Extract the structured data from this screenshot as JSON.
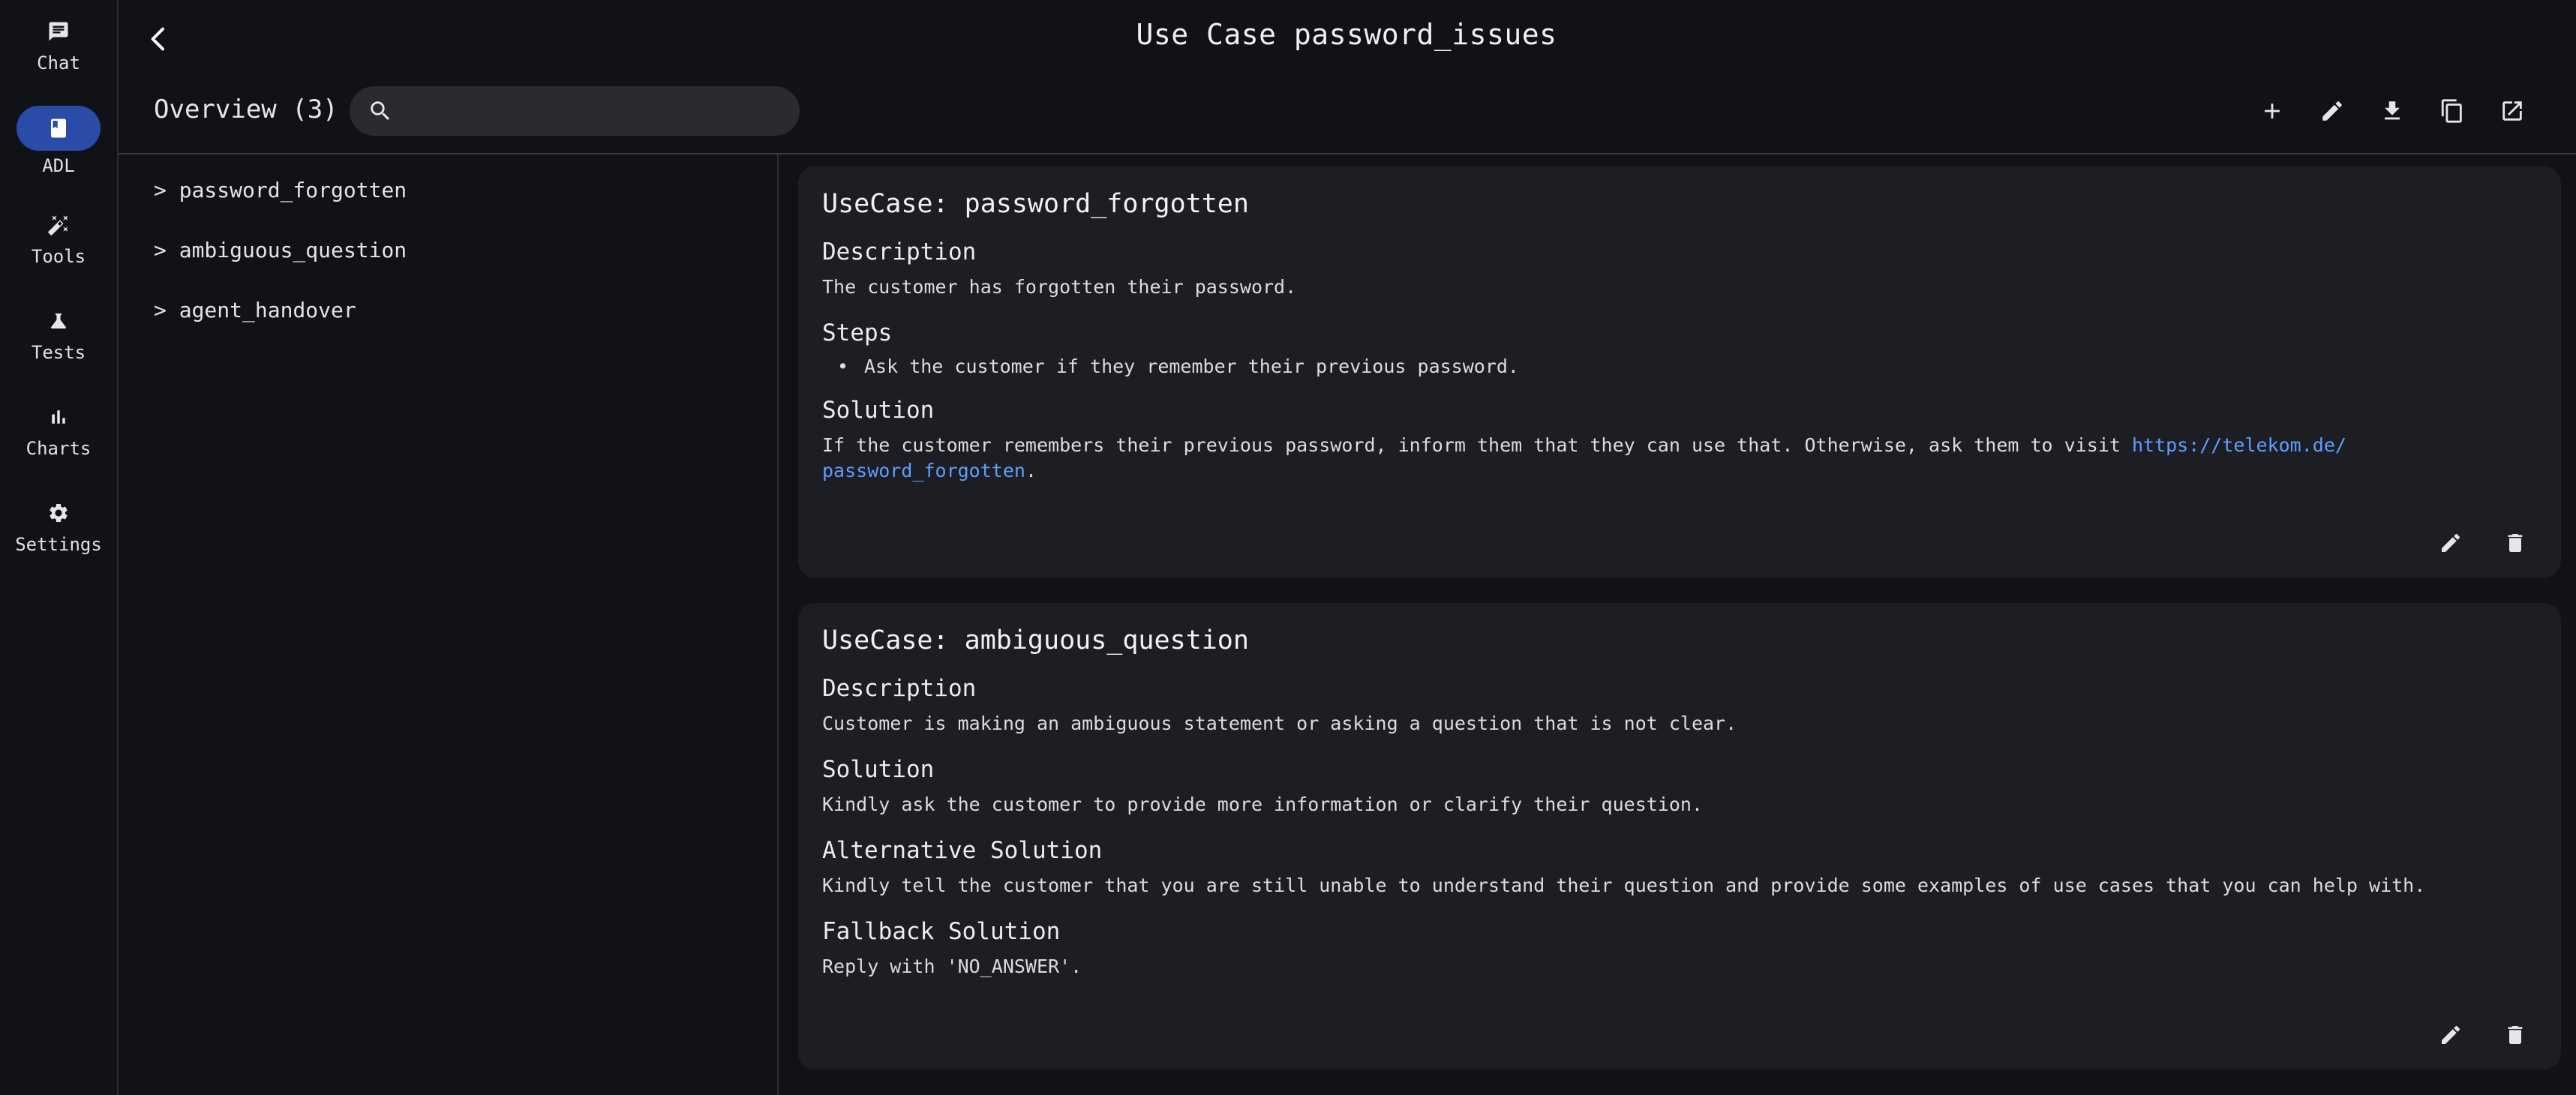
{
  "nav": {
    "items": [
      {
        "label": "Chat",
        "icon": "chat-icon",
        "active": false
      },
      {
        "label": "ADL",
        "icon": "book-icon",
        "active": true
      },
      {
        "label": "Tools",
        "icon": "magic-wand-icon",
        "active": false
      },
      {
        "label": "Tests",
        "icon": "flask-icon",
        "active": false
      },
      {
        "label": "Charts",
        "icon": "bar-chart-icon",
        "active": false
      },
      {
        "label": "Settings",
        "icon": "gear-icon",
        "active": false
      }
    ]
  },
  "header": {
    "title": "Use Case password_issues"
  },
  "overview": {
    "title": "Overview (3)",
    "search_value": "",
    "toolbar_icons": [
      "plus-icon",
      "pencil-icon",
      "download-icon",
      "copy-icon",
      "open-external-icon"
    ]
  },
  "tree": {
    "items": [
      "> password_forgotten",
      "> ambiguous_question",
      "> agent_handover"
    ]
  },
  "cards": [
    {
      "title": "UseCase: password_forgotten",
      "description_heading": "Description",
      "description": "The customer has forgotten their password.",
      "steps_heading": "Steps",
      "step_1": "Ask the customer if they remember their previous password.",
      "solution_heading": "Solution",
      "solution_text": "If the customer remembers their previous password, inform them that they can use that. Otherwise, ask them to visit ",
      "solution_link_line1": "https://telekom.de/",
      "solution_link_line2": "password_forgotten",
      "solution_end": "."
    },
    {
      "title": "UseCase: ambiguous_question",
      "description_heading": "Description",
      "description": "Customer is making an ambiguous statement or asking a question that is not clear.",
      "solution_heading": "Solution",
      "solution": "Kindly ask the customer to provide more information or clarify their question.",
      "alt_heading": "Alternative Solution",
      "alt": "Kindly tell the customer that you are still unable to understand their question and provide some examples of use cases that you can help with.",
      "fallback_heading": "Fallback Solution",
      "fallback": "Reply with 'NO_ANSWER'."
    }
  ],
  "colors": {
    "background": "#111217",
    "card": "#1d1e23",
    "accent": "#2a4ca8",
    "link": "#5f9dff"
  }
}
